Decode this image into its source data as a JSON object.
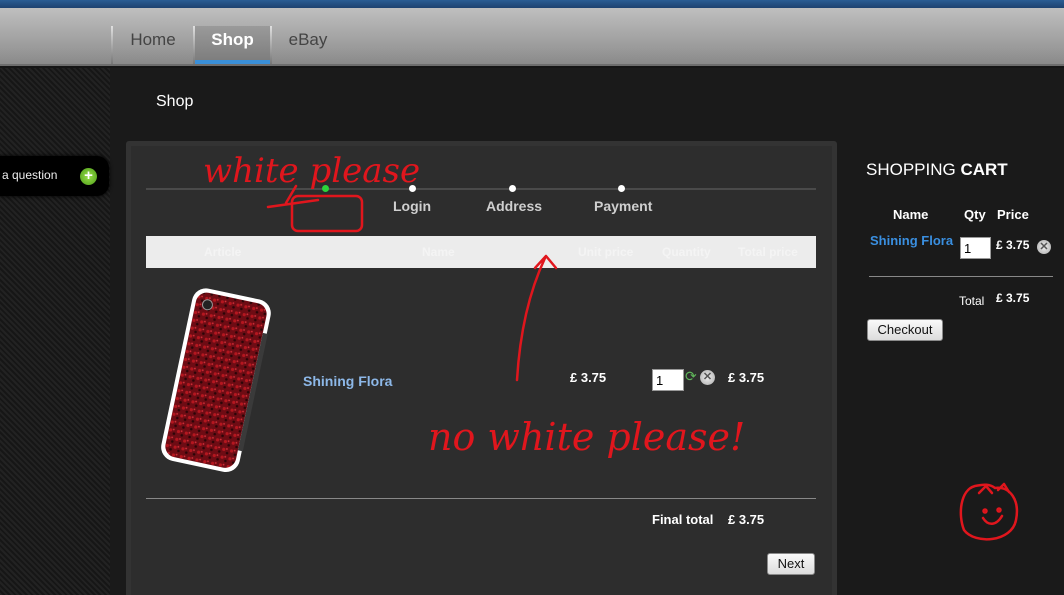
{
  "nav": {
    "items": [
      {
        "label": "Home"
      },
      {
        "label": "Shop"
      },
      {
        "label": "eBay"
      }
    ]
  },
  "sidebar": {
    "question_label": "a question",
    "plus_glyph": "+"
  },
  "page": {
    "title": "Shop"
  },
  "checkout": {
    "steps": [
      {
        "label": ""
      },
      {
        "label": "Login"
      },
      {
        "label": "Address"
      },
      {
        "label": "Payment"
      }
    ],
    "table_headers": [
      "Article",
      "Name",
      "Unit price",
      "Quantity",
      "Total price"
    ],
    "item": {
      "name": "Shining Flora",
      "unit_price": "£ 3.75",
      "quantity": "1",
      "total_price": "£ 3.75"
    },
    "final_total_label": "Final total",
    "final_total_value": "£ 3.75",
    "next_label": "Next"
  },
  "cart": {
    "title_light": "SHOPPING ",
    "title_bold": "CART",
    "headers": {
      "name": "Name",
      "qty": "Qty",
      "price": "Price"
    },
    "item": {
      "name": "Shining Flora",
      "quantity": "1",
      "price": "£ 3.75"
    },
    "total_label": "Total",
    "total_value": "£ 3.75",
    "checkout_label": "Checkout"
  },
  "annotations": {
    "top": "white please",
    "middle": "no white please!"
  },
  "colors": {
    "accent": "#3a8fd8",
    "link": "#8db8e8",
    "cart_link": "#3a8fe0",
    "annotation": "#e0161d",
    "active_step": "#2bd43a"
  },
  "icons": {
    "remove": "close-circle-icon",
    "refresh": "refresh-icon",
    "plus": "plus-circle-icon"
  }
}
